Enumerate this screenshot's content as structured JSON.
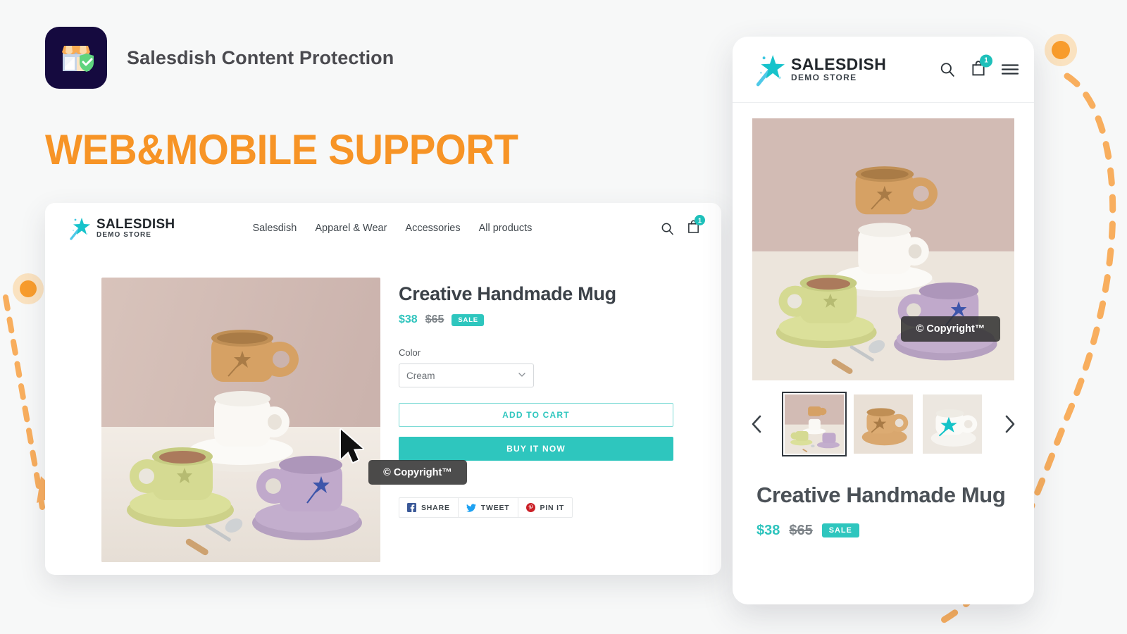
{
  "app": {
    "title": "Salesdish Content Protection",
    "logo_icon": "storefront-shield-icon"
  },
  "headline": "WEB&MOBILE SUPPORT",
  "colors": {
    "accent_teal": "#2ec6be",
    "accent_orange": "#f79426",
    "page_bg": "#f7f8f8",
    "logo_bg": "#150a3f",
    "tooltip_bg": "rgba(48,48,48,0.86)"
  },
  "desktop": {
    "brand": {
      "name": "SALESDISH",
      "subtitle": "DEMO STORE",
      "icon": "magic-wand-star-icon"
    },
    "nav": [
      {
        "label": "Salesdish"
      },
      {
        "label": "Apparel & Wear"
      },
      {
        "label": "Accessories"
      },
      {
        "label": "All products"
      }
    ],
    "icons": {
      "search": "search-icon",
      "cart": "shopping-bag-icon",
      "cart_count": "1"
    },
    "product": {
      "title": "Creative Handmade Mug",
      "price": "$38",
      "compare_price": "$65",
      "sale_badge": "SALE",
      "option_label": "Color",
      "option_value": "Cream",
      "add_to_cart": "ADD TO CART",
      "buy_now": "BUY IT NOW"
    },
    "share": [
      {
        "label": "SHARE",
        "icon": "facebook-icon"
      },
      {
        "label": "TWEET",
        "icon": "twitter-icon"
      },
      {
        "label": "PIN IT",
        "icon": "pinterest-icon"
      }
    ],
    "tooltip": "© Copyright™",
    "cursor": "arrow-cursor-icon"
  },
  "mobile": {
    "brand": {
      "name": "SALESDISH",
      "subtitle": "DEMO STORE",
      "icon": "magic-wand-star-icon"
    },
    "icons": {
      "search": "search-icon",
      "cart": "shopping-bag-icon",
      "cart_count": "1",
      "menu": "hamburger-menu-icon"
    },
    "carousel": {
      "prev_icon": "chevron-left-icon",
      "next_icon": "chevron-right-icon",
      "thumbnails": [
        {
          "name": "mug-group-thumbnail",
          "selected": true
        },
        {
          "name": "tan-mug-thumbnail",
          "selected": false
        },
        {
          "name": "white-mug-thumbnail",
          "selected": false
        }
      ]
    },
    "product": {
      "title": "Creative Handmade Mug",
      "price": "$38",
      "compare_price": "$65",
      "sale_badge": "SALE"
    },
    "tooltip": "© Copyright™"
  }
}
